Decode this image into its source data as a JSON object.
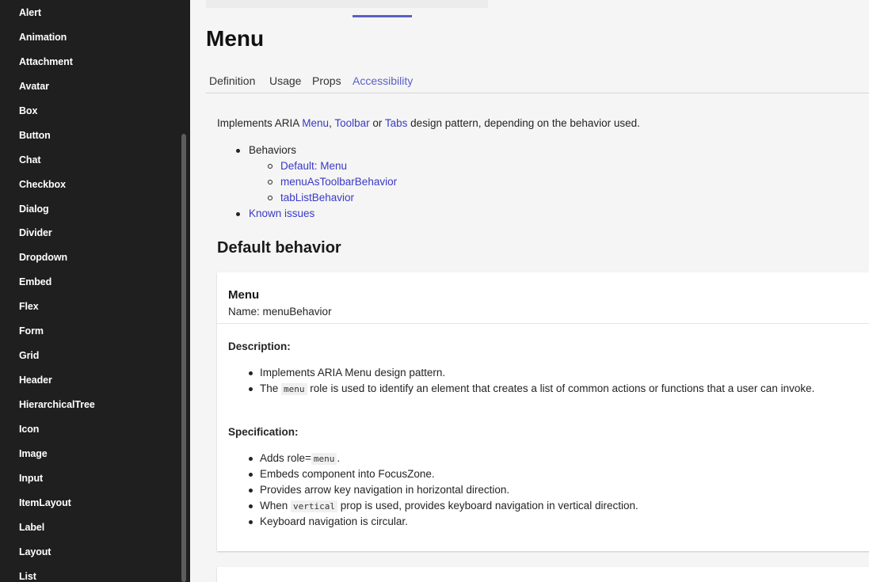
{
  "sidebar": {
    "items": [
      "Alert",
      "Animation",
      "Attachment",
      "Avatar",
      "Box",
      "Button",
      "Chat",
      "Checkbox",
      "Dialog",
      "Divider",
      "Dropdown",
      "Embed",
      "Flex",
      "Form",
      "Grid",
      "Header",
      "HierarchicalTree",
      "Icon",
      "Image",
      "Input",
      "ItemLayout",
      "Label",
      "Layout",
      "List"
    ]
  },
  "page": {
    "title": "Menu",
    "tabs": [
      "Definition",
      "Usage",
      "Props",
      "Accessibility"
    ],
    "active_tab": "Accessibility"
  },
  "intro": {
    "prefix": "Implements ARIA ",
    "link_menu": "Menu",
    "comma": ", ",
    "link_toolbar": "Toolbar",
    "or": " or ",
    "link_tabs": "Tabs",
    "suffix": " design pattern, depending on the behavior used."
  },
  "toc": {
    "behaviors": "Behaviors",
    "sub": [
      "Default: Menu",
      "menuAsToolbarBehavior",
      "tabListBehavior"
    ],
    "known_issues": "Known issues"
  },
  "default_behavior": {
    "heading": "Default behavior",
    "card": {
      "title": "Menu",
      "name": "Name: menuBehavior",
      "description_label": "Description:",
      "description": {
        "item1": "Implements ARIA Menu design pattern.",
        "item2_pre": "The ",
        "item2_code": "menu",
        "item2_post": " role is used to identify an element that creates a list of common actions or functions that a user can invoke."
      },
      "specification_label": "Specification:",
      "specification": {
        "item1_pre": "Adds role=",
        "item1_code": "menu",
        "item1_post": ".",
        "item2": "Embeds component into FocusZone.",
        "item3": "Provides arrow key navigation in horizontal direction.",
        "item4_pre": "When ",
        "item4_code": "vertical",
        "item4_post": " prop is used, provides keyboard navigation in vertical direction.",
        "item5": "Keyboard navigation is circular."
      }
    }
  },
  "colors": {
    "sidebar_bg": "#1f1f1f",
    "accent": "#5b5fc7",
    "link": "#3939c6",
    "page_bg": "#f5f5f5"
  }
}
